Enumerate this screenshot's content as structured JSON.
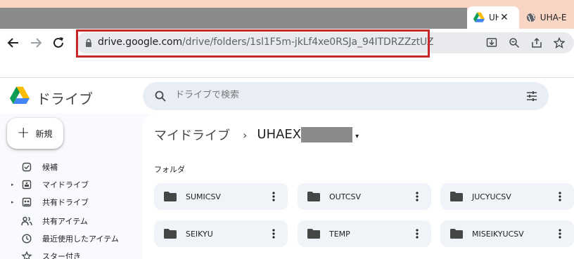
{
  "browser": {
    "tabs": [
      {
        "title": "UHAEX",
        "active": true,
        "favicon": "google-drive-icon",
        "close": "✕"
      },
      {
        "title": "UHA-E",
        "active": false,
        "favicon": "globe-icon"
      }
    ],
    "url_host": "drive.google.com",
    "url_path": "/drive/folders/1sl1F5m-jkLf4xe0RSJa_94ITDRZZztUZ",
    "highlight_color": "#c62828"
  },
  "drive": {
    "title": "ドライブ",
    "search_placeholder": "ドライブで検索",
    "new_label": "新規",
    "sidebar": [
      {
        "label": "候補",
        "icon": "check-box-icon",
        "expandable": false
      },
      {
        "label": "マイドライブ",
        "icon": "my-drive-icon",
        "expandable": true
      },
      {
        "label": "共有ドライブ",
        "icon": "shared-drive-icon",
        "expandable": true
      },
      {
        "label": "共有アイテム",
        "icon": "people-icon",
        "expandable": false
      },
      {
        "label": "最近使用したアイテム",
        "icon": "clock-icon",
        "expandable": false
      },
      {
        "label": "スター付き",
        "icon": "star-icon",
        "expandable": false
      }
    ],
    "breadcrumb": {
      "root": "マイドライブ",
      "separator": "›",
      "current": "UHAEX",
      "caret": "▾"
    },
    "section_label": "フォルダ",
    "folders": [
      {
        "name": "SUMICSV"
      },
      {
        "name": "OUTCSV"
      },
      {
        "name": "JUCYUCSV"
      },
      {
        "name": "SEIKYU"
      },
      {
        "name": "TEMP"
      },
      {
        "name": "MISEIKYUCSV"
      }
    ]
  }
}
